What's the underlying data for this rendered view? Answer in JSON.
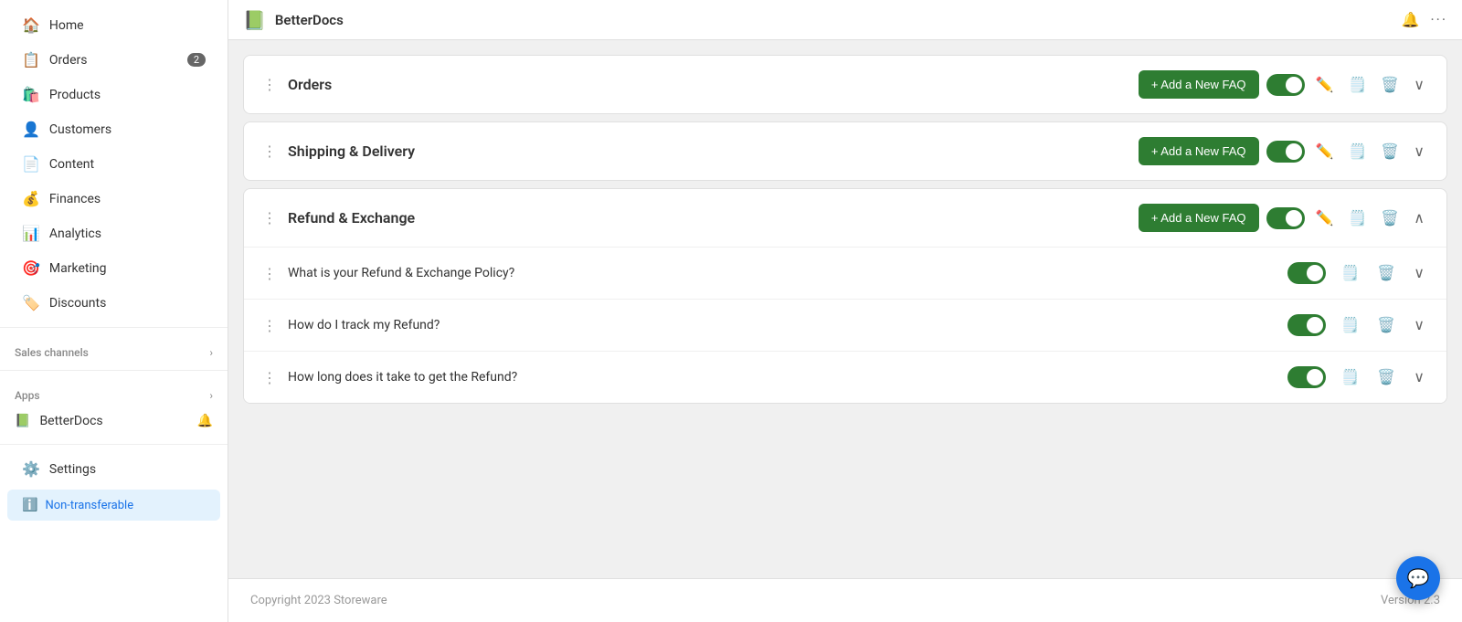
{
  "sidebar": {
    "nav_items": [
      {
        "id": "home",
        "label": "Home",
        "icon": "🏠",
        "badge": null,
        "active": false
      },
      {
        "id": "orders",
        "label": "Orders",
        "icon": "📋",
        "badge": "2",
        "active": false
      },
      {
        "id": "products",
        "label": "Products",
        "icon": "🛍️",
        "badge": null,
        "active": false
      },
      {
        "id": "customers",
        "label": "Customers",
        "icon": "👤",
        "badge": null,
        "active": false
      },
      {
        "id": "content",
        "label": "Content",
        "icon": "📄",
        "badge": null,
        "active": false
      },
      {
        "id": "finances",
        "label": "Finances",
        "icon": "💰",
        "badge": null,
        "active": false
      },
      {
        "id": "analytics",
        "label": "Analytics",
        "icon": "📊",
        "badge": null,
        "active": false
      },
      {
        "id": "marketing",
        "label": "Marketing",
        "icon": "🎯",
        "badge": null,
        "active": false
      },
      {
        "id": "discounts",
        "label": "Discounts",
        "icon": "🏷️",
        "badge": null,
        "active": false
      }
    ],
    "sales_channels_label": "Sales channels",
    "apps_label": "Apps",
    "betterdocs_label": "BetterDocs",
    "settings_label": "Settings",
    "non_transferable_label": "Non-transferable"
  },
  "topbar": {
    "app_name": "BetterDocs",
    "logo": "📗",
    "dots_label": "···"
  },
  "faq_sections": [
    {
      "id": "orders",
      "title": "Orders",
      "toggle_on": true,
      "items": []
    },
    {
      "id": "shipping",
      "title": "Shipping & Delivery",
      "toggle_on": true,
      "items": []
    },
    {
      "id": "refund",
      "title": "Refund & Exchange",
      "toggle_on": true,
      "items": [
        {
          "id": "q1",
          "question": "What is your Refund & Exchange Policy?",
          "toggle_on": true
        },
        {
          "id": "q2",
          "question": "How do I track my Refund?",
          "toggle_on": true
        },
        {
          "id": "q3",
          "question": "How long does it take to get the Refund?",
          "toggle_on": true
        }
      ]
    }
  ],
  "add_faq_label": "+ Add a New FAQ",
  "footer": {
    "copyright": "Copyright 2023 Storeware",
    "version": "Version 2.3"
  }
}
